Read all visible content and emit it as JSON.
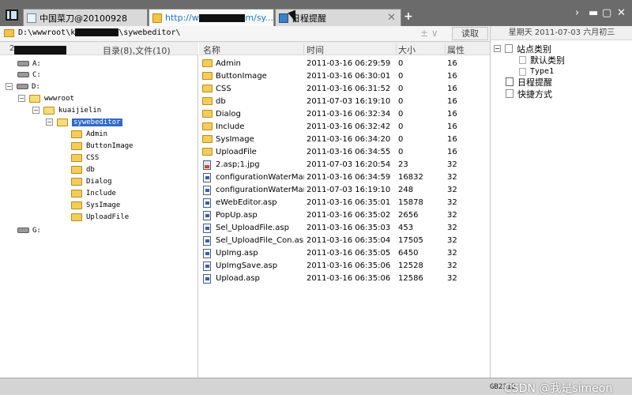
{
  "tabs": [
    {
      "label": "中国菜刀@20100928",
      "icon": "page-icon"
    },
    {
      "label_prefix": "http://w",
      "label_suffix": "m/sy...",
      "icon": "folder-icon"
    },
    {
      "label": "日程提醒",
      "icon": "calendar-icon"
    }
  ],
  "address": {
    "path_prefix": "D:\\wwwroot\\k",
    "path_suffix": "\\sywebeditor\\",
    "read_button": "读取",
    "tools": "± ∨"
  },
  "tree": {
    "header_num": "2",
    "header_count": "目录(8),文件(10)",
    "drives": [
      "A:",
      "C:",
      "D:",
      "G:"
    ],
    "folders": {
      "wwwroot": "wwwroot",
      "kuaijielin": "kuaijielin",
      "sywebeditor": "sywebeditor",
      "children": [
        "Admin",
        "ButtonImage",
        "CSS",
        "db",
        "Dialog",
        "Include",
        "SysImage",
        "UploadFile"
      ]
    }
  },
  "list": {
    "columns": {
      "name": "名称",
      "time": "时间",
      "size": "大小",
      "attr": "属性"
    },
    "rows": [
      {
        "type": "folder",
        "name": "Admin",
        "time": "2011-03-16 06:29:59",
        "size": "0",
        "attr": "16"
      },
      {
        "type": "folder",
        "name": "ButtonImage",
        "time": "2011-03-16 06:30:01",
        "size": "0",
        "attr": "16"
      },
      {
        "type": "folder",
        "name": "CSS",
        "time": "2011-03-16 06:31:52",
        "size": "0",
        "attr": "16"
      },
      {
        "type": "folder",
        "name": "db",
        "time": "2011-07-03 16:19:10",
        "size": "0",
        "attr": "16"
      },
      {
        "type": "folder",
        "name": "Dialog",
        "time": "2011-03-16 06:32:34",
        "size": "0",
        "attr": "16"
      },
      {
        "type": "folder",
        "name": "Include",
        "time": "2011-03-16 06:32:42",
        "size": "0",
        "attr": "16"
      },
      {
        "type": "folder",
        "name": "SysImage",
        "time": "2011-03-16 06:34:20",
        "size": "0",
        "attr": "16"
      },
      {
        "type": "folder",
        "name": "UploadFile",
        "time": "2011-03-16 06:34:55",
        "size": "0",
        "attr": "16"
      },
      {
        "type": "image",
        "name": "2.asp;1.jpg",
        "time": "2011-07-03 16:20:54",
        "size": "23",
        "attr": "32"
      },
      {
        "type": "file",
        "name": "configurationWaterMark....",
        "time": "2011-03-16 06:34:59",
        "size": "16832",
        "attr": "32"
      },
      {
        "type": "file",
        "name": "configurationWaterMark....",
        "time": "2011-07-03 16:19:10",
        "size": "248",
        "attr": "32"
      },
      {
        "type": "file",
        "name": "eWebEditor.asp",
        "time": "2011-03-16 06:35:01",
        "size": "15878",
        "attr": "32"
      },
      {
        "type": "file",
        "name": "PopUp.asp",
        "time": "2011-03-16 06:35:02",
        "size": "2656",
        "attr": "32"
      },
      {
        "type": "file",
        "name": "Sel_UploadFile.asp",
        "time": "2011-03-16 06:35:03",
        "size": "453",
        "attr": "32"
      },
      {
        "type": "file",
        "name": "Sel_UploadFile_Con.asp",
        "time": "2011-03-16 06:35:04",
        "size": "17505",
        "attr": "32"
      },
      {
        "type": "file",
        "name": "UpImg.asp",
        "time": "2011-03-16 06:35:05",
        "size": "6450",
        "attr": "32"
      },
      {
        "type": "file",
        "name": "UpImgSave.asp",
        "time": "2011-03-16 06:35:06",
        "size": "12528",
        "attr": "32"
      },
      {
        "type": "file",
        "name": "Upload.asp",
        "time": "2011-03-16 06:35:06",
        "size": "12586",
        "attr": "32"
      }
    ]
  },
  "right": {
    "date": "星期天 2011-07-03 六月初三",
    "site_category": "站点类别",
    "default_category": "默认类别",
    "type1": "Type1",
    "schedule": "日程提醒",
    "shortcut": "快捷方式"
  },
  "status": {
    "encoding": "GB2312",
    "watermark": "CSDN @我是simeon"
  },
  "colors": {
    "tabbar": "#6b6b6b",
    "selection": "#3169c6",
    "status": "#d4d4d4"
  }
}
